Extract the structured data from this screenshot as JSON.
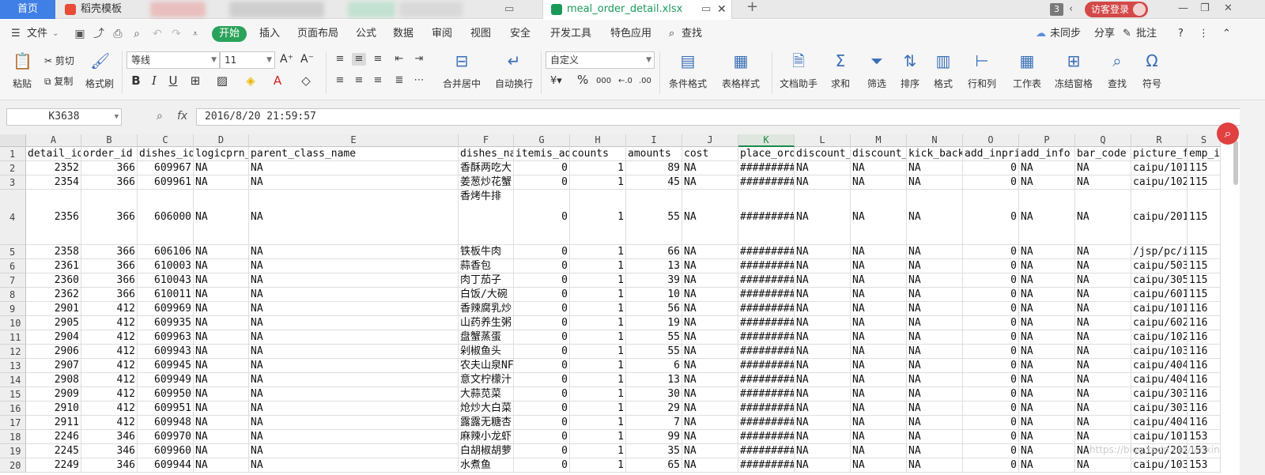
{
  "tabs": {
    "home": "首页",
    "template": "稻壳模板",
    "file": "meal_order_detail.xlsx",
    "count_badge": "3",
    "visitor_login": "访客登录",
    "add": "+"
  },
  "menu": {
    "file": "文件",
    "items": [
      "开始",
      "插入",
      "页面布局",
      "公式",
      "数据",
      "审阅",
      "视图",
      "安全",
      "开发工具",
      "特色应用"
    ],
    "search": "查找",
    "unsync": "未同步",
    "share": "分享",
    "comment": "批注",
    "help": "?",
    "more": "⋮"
  },
  "ribbon": {
    "paste": "粘贴",
    "cut": "剪切",
    "copy": "复制",
    "format_painter": "格式刷",
    "font_name": "等线",
    "font_size": "11",
    "number_format": "自定义",
    "merge_center": "合并居中",
    "wrap_text": "自动换行",
    "cond_format": "条件格式",
    "table_style": "表格样式",
    "doc_helper": "文档助手",
    "sum": "求和",
    "filter": "筛选",
    "sort": "排序",
    "format": "格式",
    "row_col": "行和列",
    "worksheet": "工作表",
    "freeze": "冻结窗格",
    "find": "查找",
    "symbol": "符号"
  },
  "formula_bar": {
    "name_box": "K3638",
    "fx": "fx",
    "content": "2016/8/20 21:59:57"
  },
  "columns": [
    "A",
    "B",
    "C",
    "D",
    "E",
    "F",
    "G",
    "H",
    "I",
    "J",
    "K",
    "L",
    "M",
    "N",
    "O",
    "P",
    "Q",
    "R",
    "S"
  ],
  "selected_column": "K",
  "rows": [
    {
      "n": "1",
      "c": [
        "detail_id",
        "order_id",
        "dishes_id",
        "logicprn_",
        "parent_class_name",
        "dishes_name",
        "itemis_ad",
        "counts",
        "amounts",
        "cost",
        "place_orde",
        "discount_",
        "discount_",
        "kick_back",
        "add_inpri",
        "add_info",
        "bar_code",
        "picture_f",
        "emp_id"
      ]
    },
    {
      "n": "2",
      "c": [
        "2352",
        "366",
        "609967",
        "NA",
        "NA",
        "香酥两吃大",
        "0",
        "1",
        "89",
        "NA",
        "##########",
        "NA",
        "NA",
        "NA",
        "0",
        "NA",
        "NA",
        "caipu/101",
        "115"
      ]
    },
    {
      "n": "3",
      "c": [
        "2354",
        "366",
        "609961",
        "NA",
        "NA",
        "姜葱炒花蟹",
        "0",
        "1",
        "45",
        "NA",
        "##########",
        "NA",
        "NA",
        "NA",
        "0",
        "NA",
        "NA",
        "caipu/102",
        "115"
      ]
    },
    {
      "n": "4",
      "c": [
        "2356",
        "366",
        "606000",
        "NA",
        "NA",
        "香烤牛排",
        "0",
        "1",
        "55",
        "NA",
        "##########",
        "NA",
        "NA",
        "NA",
        "0",
        "NA",
        "NA",
        "caipu/201",
        "115"
      ]
    },
    {
      "n": "5",
      "c": [
        "2358",
        "366",
        "606106",
        "NA",
        "NA",
        "铁板牛肉",
        "0",
        "1",
        "66",
        "NA",
        "##########",
        "NA",
        "NA",
        "NA",
        "0",
        "NA",
        "NA",
        "/jsp/pc/i",
        "115"
      ]
    },
    {
      "n": "6",
      "c": [
        "2361",
        "366",
        "610003",
        "NA",
        "NA",
        "蒜香包",
        "0",
        "1",
        "13",
        "NA",
        "##########",
        "NA",
        "NA",
        "NA",
        "0",
        "NA",
        "NA",
        "caipu/503",
        "115"
      ]
    },
    {
      "n": "7",
      "c": [
        "2360",
        "366",
        "610043",
        "NA",
        "NA",
        "肉丁茄子",
        "0",
        "1",
        "39",
        "NA",
        "##########",
        "NA",
        "NA",
        "NA",
        "0",
        "NA",
        "NA",
        "caipu/305",
        "115"
      ]
    },
    {
      "n": "8",
      "c": [
        "2362",
        "366",
        "610011",
        "NA",
        "NA",
        "白饭/大碗",
        "0",
        "1",
        "10",
        "NA",
        "##########",
        "NA",
        "NA",
        "NA",
        "0",
        "NA",
        "NA",
        "caipu/601",
        "115"
      ]
    },
    {
      "n": "9",
      "c": [
        "2901",
        "412",
        "609969",
        "NA",
        "NA",
        "香辣腐乳炒",
        "0",
        "1",
        "56",
        "NA",
        "##########",
        "NA",
        "NA",
        "NA",
        "0",
        "NA",
        "NA",
        "caipu/101",
        "116"
      ]
    },
    {
      "n": "10",
      "c": [
        "2905",
        "412",
        "609935",
        "NA",
        "NA",
        "山药养生粥",
        "0",
        "1",
        "19",
        "NA",
        "##########",
        "NA",
        "NA",
        "NA",
        "0",
        "NA",
        "NA",
        "caipu/602",
        "116"
      ]
    },
    {
      "n": "11",
      "c": [
        "2904",
        "412",
        "609963",
        "NA",
        "NA",
        "盘蟹蒸蛋",
        "0",
        "1",
        "55",
        "NA",
        "##########",
        "NA",
        "NA",
        "NA",
        "0",
        "NA",
        "NA",
        "caipu/102",
        "116"
      ]
    },
    {
      "n": "12",
      "c": [
        "2906",
        "412",
        "609943",
        "NA",
        "NA",
        "剁椒鱼头",
        "0",
        "1",
        "55",
        "NA",
        "##########",
        "NA",
        "NA",
        "NA",
        "0",
        "NA",
        "NA",
        "caipu/103",
        "116"
      ]
    },
    {
      "n": "13",
      "c": [
        "2907",
        "412",
        "609945",
        "NA",
        "NA",
        "农夫山泉NF",
        "0",
        "1",
        "6",
        "NA",
        "##########",
        "NA",
        "NA",
        "NA",
        "0",
        "NA",
        "NA",
        "caipu/404",
        "116"
      ]
    },
    {
      "n": "14",
      "c": [
        "2908",
        "412",
        "609949",
        "NA",
        "NA",
        "意文柠檬汁",
        "0",
        "1",
        "13",
        "NA",
        "##########",
        "NA",
        "NA",
        "NA",
        "0",
        "NA",
        "NA",
        "caipu/404",
        "116"
      ]
    },
    {
      "n": "15",
      "c": [
        "2909",
        "412",
        "609950",
        "NA",
        "NA",
        "大蒜苋菜",
        "0",
        "1",
        "30",
        "NA",
        "##########",
        "NA",
        "NA",
        "NA",
        "0",
        "NA",
        "NA",
        "caipu/303",
        "116"
      ]
    },
    {
      "n": "16",
      "c": [
        "2910",
        "412",
        "609951",
        "NA",
        "NA",
        "炝炒大白菜",
        "0",
        "1",
        "29",
        "NA",
        "##########",
        "NA",
        "NA",
        "NA",
        "0",
        "NA",
        "NA",
        "caipu/303",
        "116"
      ]
    },
    {
      "n": "17",
      "c": [
        "2911",
        "412",
        "609948",
        "NA",
        "NA",
        "露露无糖杏",
        "0",
        "1",
        "7",
        "NA",
        "##########",
        "NA",
        "NA",
        "NA",
        "0",
        "NA",
        "NA",
        "caipu/404",
        "116"
      ]
    },
    {
      "n": "18",
      "c": [
        "2246",
        "346",
        "609970",
        "NA",
        "NA",
        "麻辣小龙虾",
        "0",
        "1",
        "99",
        "NA",
        "##########",
        "NA",
        "NA",
        "NA",
        "0",
        "NA",
        "NA",
        "caipu/101",
        "153"
      ]
    },
    {
      "n": "19",
      "c": [
        "2245",
        "346",
        "609960",
        "NA",
        "NA",
        "白胡椒胡萝",
        "0",
        "1",
        "35",
        "NA",
        "##########",
        "NA",
        "NA",
        "NA",
        "0",
        "NA",
        "NA",
        "caipu/202",
        "153"
      ]
    },
    {
      "n": "20",
      "c": [
        "2249",
        "346",
        "609944",
        "NA",
        "NA",
        "水煮鱼",
        "0",
        "1",
        "65",
        "NA",
        "##########",
        "NA",
        "NA",
        "NA",
        "0",
        "NA",
        "NA",
        "caipu/103",
        "153"
      ]
    }
  ],
  "watermark": "https://blog.csdn.net/lanxin"
}
